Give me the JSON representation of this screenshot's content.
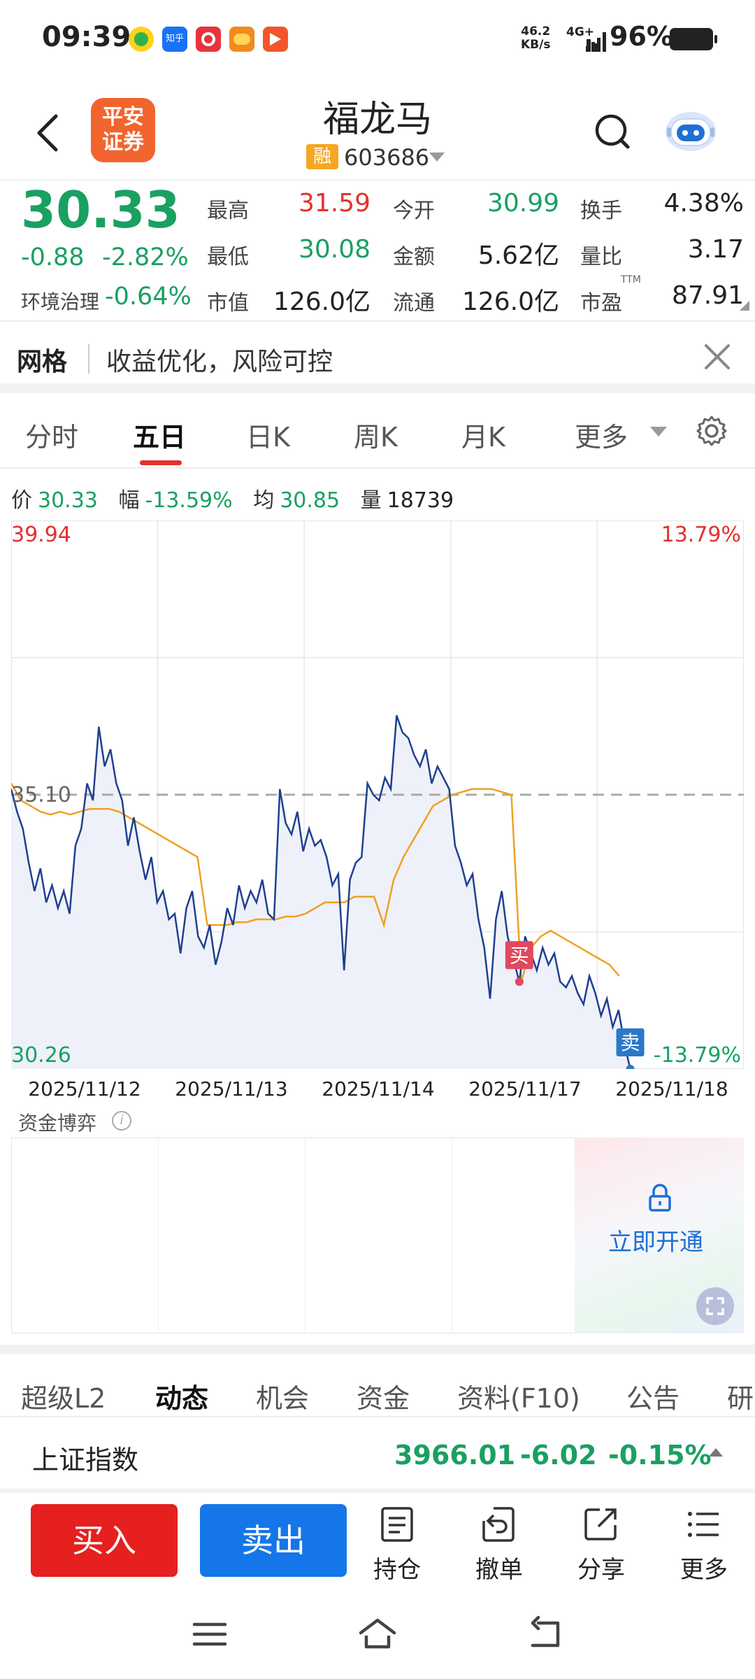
{
  "status_bar": {
    "time": "09:39",
    "net_speed_value": "46.2",
    "net_speed_unit": "KB/s",
    "network": "4G+",
    "battery": "96%",
    "app_icons": [
      "green-circle-app-icon",
      "zhihu-app-icon",
      "red-app-icon",
      "orange-app-icon",
      "orange-red-app-icon"
    ],
    "zhihu_label": "知乎"
  },
  "header": {
    "broker_logo_line1": "平安",
    "broker_logo_line2": "证券",
    "stock_name": "福龙马",
    "margin_badge": "融",
    "stock_code": "603686"
  },
  "quote": {
    "price": "30.33",
    "change": "-0.88",
    "change_pct": "-2.82%",
    "sector": "环境治理",
    "sector_pct": "-0.64%",
    "high_label": "最高",
    "high": "31.59",
    "low_label": "最低",
    "low": "30.08",
    "market_cap_label": "市值",
    "market_cap": "126.0亿",
    "open_label": "今开",
    "open": "30.99",
    "amount_label": "金额",
    "amount": "5.62亿",
    "float_cap_label": "流通",
    "float_cap": "126.0亿",
    "turnover_label": "换手",
    "turnover": "4.38%",
    "volume_ratio_label": "量比",
    "volume_ratio": "3.17",
    "pe_label": "市盈",
    "pe_sup": "TTM",
    "pe": "87.91"
  },
  "style_tag": {
    "title": "网格",
    "text": "收益优化，风险可控"
  },
  "chart_tabs": [
    "分时",
    "五日",
    "日K",
    "周K",
    "月K",
    "更多"
  ],
  "chart_info": {
    "price_label": "价",
    "price": "30.33",
    "range_label": "幅",
    "range": "-13.59%",
    "avg_label": "均",
    "avg": "30.85",
    "vol_label": "量",
    "vol": "18739"
  },
  "chart_data": {
    "type": "line",
    "x": [
      "2025/11/12",
      "2025/11/13",
      "2025/11/14",
      "2025/11/17",
      "2025/11/18"
    ],
    "ylim": [
      30.26,
      39.94
    ],
    "ylim_pct": [
      "-13.79%",
      "13.79%"
    ],
    "ref_price": "35.10",
    "y_top_label": "39.94",
    "y_bottom_label": "30.26",
    "pct_top_label": "13.79%",
    "pct_bottom_label": "-13.79%",
    "series": [
      {
        "role": "price",
        "color": "#1f3f8f",
        "values": [
          35.2,
          34.8,
          34.5,
          33.9,
          33.4,
          33.8,
          33.2,
          33.5,
          33.1,
          33.4,
          33.0,
          34.2,
          34.5,
          35.3,
          35.0,
          36.3,
          35.6,
          35.9,
          35.3,
          35.0,
          34.2,
          34.7,
          34.1,
          33.6,
          34.0,
          33.2,
          33.4,
          32.9,
          33.0,
          32.3,
          33.1,
          33.4,
          32.6,
          32.4,
          32.8,
          32.1,
          32.5,
          33.1,
          32.8,
          33.5,
          33.1,
          33.4,
          33.2,
          33.6,
          33.0,
          32.9,
          35.2,
          34.6,
          34.4,
          34.8,
          34.1,
          34.5,
          34.2,
          34.3,
          34.0,
          33.5,
          33.7,
          32.0,
          33.6,
          33.9,
          34.0,
          35.3,
          35.1,
          35.0,
          35.4,
          35.2,
          36.5,
          36.2,
          36.1,
          35.8,
          35.6,
          35.9,
          35.3,
          35.6,
          35.4,
          35.2,
          34.2,
          33.9,
          33.5,
          33.7,
          32.9,
          32.4,
          31.5,
          32.9,
          33.4,
          32.6,
          32.2,
          31.8,
          32.6,
          32.3,
          32.0,
          32.4,
          32.1,
          32.3,
          31.8,
          31.7,
          31.9,
          31.6,
          31.4,
          31.9,
          31.6,
          31.2,
          31.5,
          31.0,
          31.3,
          30.7,
          30.26
        ],
        "marker_buy_index": 87,
        "marker_sell_index": 106
      },
      {
        "role": "average",
        "color": "#f0a023",
        "values": [
          35.3,
          35.0,
          34.9,
          34.8,
          34.75,
          34.8,
          34.75,
          34.8,
          34.85,
          34.85,
          34.85,
          34.8,
          34.7,
          34.6,
          34.5,
          34.4,
          34.3,
          34.2,
          34.1,
          34.0,
          32.8,
          32.8,
          32.8,
          32.85,
          32.85,
          32.9,
          32.9,
          32.9,
          32.95,
          32.95,
          33.0,
          33.1,
          33.2,
          33.2,
          33.2,
          33.3,
          33.3,
          33.3,
          32.8,
          33.6,
          34.0,
          34.3,
          34.6,
          34.9,
          35.0,
          35.1,
          35.15,
          35.2,
          35.2,
          35.2,
          35.15,
          35.1,
          31.8,
          32.4,
          32.6,
          32.7,
          32.6,
          32.5,
          32.4,
          32.3,
          32.2,
          32.1,
          31.9
        ]
      }
    ]
  },
  "markers": {
    "buy": "买",
    "sell": "卖"
  },
  "fund_game": {
    "title": "资金博弈",
    "info_glyph": "i",
    "unlock_text": "立即开通"
  },
  "info_tabs": [
    "超级L2",
    "动态",
    "机会",
    "资金",
    "资料(F10)",
    "公告",
    "研"
  ],
  "index_row": {
    "name": "上证指数",
    "value": "3966.01",
    "change": "-6.02",
    "change_pct": "-0.15%"
  },
  "actions": {
    "buy": "买入",
    "sell": "卖出",
    "items": [
      {
        "label": "持仓",
        "icon": "document-list-icon"
      },
      {
        "label": "撤单",
        "icon": "undo-order-icon"
      },
      {
        "label": "分享",
        "icon": "share-icon"
      },
      {
        "label": "更多",
        "icon": "menu-list-icon"
      }
    ]
  },
  "colors": {
    "up_red": "#e3302f",
    "down_green": "#1aa061",
    "buy_red": "#e5201f",
    "sell_blue": "#1476e8",
    "price_line": "#1f3f8f",
    "avg_line": "#f0a023"
  }
}
